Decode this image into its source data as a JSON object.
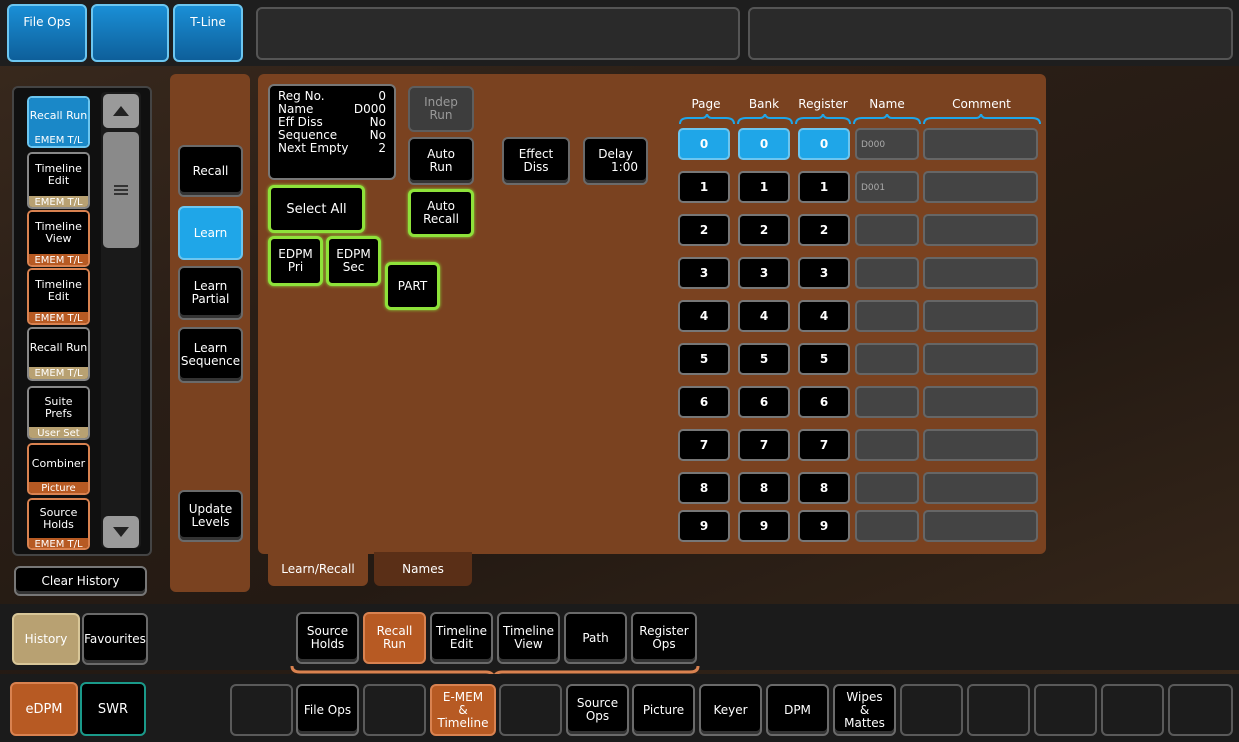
{
  "top_bar": {
    "file_ops": "File Ops",
    "t_line": "T-Line"
  },
  "history": {
    "items": [
      {
        "label": "Recall Run",
        "sub": "EMEM T/L",
        "style": "blue"
      },
      {
        "label": "Timeline Edit",
        "sub": "EMEM T/L",
        "style": "tan"
      },
      {
        "label": "Timeline View",
        "sub": "EMEM T/L",
        "style": "orange"
      },
      {
        "label": "Timeline Edit",
        "sub": "EMEM T/L",
        "style": "orange"
      },
      {
        "label": "Recall Run",
        "sub": "EMEM T/L",
        "style": "tan"
      },
      {
        "label": "Suite Prefs",
        "sub": "User Set",
        "style": "tan"
      },
      {
        "label": "Combiner",
        "sub": "Picture",
        "style": "orange"
      },
      {
        "label": "Source Holds",
        "sub": "EMEM T/L",
        "style": "orange"
      }
    ],
    "clear_label": "Clear History",
    "tab_history": "History",
    "tab_favourites": "Favourites"
  },
  "mode": {
    "edpm": "eDPM",
    "swr": "SWR"
  },
  "side_buttons": {
    "recall": "Recall",
    "learn": "Learn",
    "learn_partial": "Learn Partial",
    "learn_sequence": "Learn Sequence",
    "update_levels": "Update Levels"
  },
  "info": {
    "reg_no_label": "Reg No.",
    "reg_no": "0",
    "name_label": "Name",
    "name": "D000",
    "eff_diss_label": "Eff Diss",
    "eff_diss": "No",
    "sequence_label": "Sequence",
    "sequence": "No",
    "next_empty_label": "Next Empty",
    "next_empty": "2"
  },
  "controls": {
    "indep_run": "Indep Run",
    "auto_run": "Auto Run",
    "effect_diss": "Effect Diss",
    "delay_label": "Delay",
    "delay_value": "1:00",
    "select_all": "Select All",
    "auto_recall": "Auto Recall",
    "edpm_pri": "EDPM Pri",
    "edpm_sec": "EDPM Sec",
    "part": "PART"
  },
  "table": {
    "headers": {
      "page": "Page",
      "bank": "Bank",
      "register": "Register",
      "name": "Name",
      "comment": "Comment"
    },
    "rows": [
      {
        "page": "0",
        "bank": "0",
        "register": "0",
        "name": "D000",
        "comment": ""
      },
      {
        "page": "1",
        "bank": "1",
        "register": "1",
        "name": "D001",
        "comment": ""
      },
      {
        "page": "2",
        "bank": "2",
        "register": "2",
        "name": "",
        "comment": ""
      },
      {
        "page": "3",
        "bank": "3",
        "register": "3",
        "name": "",
        "comment": ""
      },
      {
        "page": "4",
        "bank": "4",
        "register": "4",
        "name": "",
        "comment": ""
      },
      {
        "page": "5",
        "bank": "5",
        "register": "5",
        "name": "",
        "comment": ""
      },
      {
        "page": "6",
        "bank": "6",
        "register": "6",
        "name": "",
        "comment": ""
      },
      {
        "page": "7",
        "bank": "7",
        "register": "7",
        "name": "",
        "comment": ""
      },
      {
        "page": "8",
        "bank": "8",
        "register": "8",
        "name": "",
        "comment": ""
      },
      {
        "page": "9",
        "bank": "9",
        "register": "9",
        "name": "",
        "comment": ""
      }
    ]
  },
  "panel_tabs": {
    "learn_recall": "Learn/Recall",
    "names": "Names"
  },
  "sub_tabs": [
    {
      "label": "Source Holds",
      "active": false
    },
    {
      "label": "Recall Run",
      "active": true
    },
    {
      "label": "Timeline Edit",
      "active": false
    },
    {
      "label": "Timeline View",
      "active": false
    },
    {
      "label": "Path",
      "active": false
    },
    {
      "label": "Register Ops",
      "active": false
    }
  ],
  "main_tabs": [
    {
      "label": "",
      "active": false
    },
    {
      "label": "File Ops",
      "active": false
    },
    {
      "label": "",
      "active": false
    },
    {
      "label": "E-MEM & Timeline",
      "active": true
    },
    {
      "label": "",
      "active": false
    },
    {
      "label": "Source Ops",
      "active": false
    },
    {
      "label": "Picture",
      "active": false
    },
    {
      "label": "Keyer",
      "active": false
    },
    {
      "label": "DPM",
      "active": false
    },
    {
      "label": "Wipes & Mattes",
      "active": false
    },
    {
      "label": "",
      "active": false
    },
    {
      "label": "",
      "active": false
    },
    {
      "label": "",
      "active": false
    },
    {
      "label": "",
      "active": false
    },
    {
      "label": "",
      "active": false
    }
  ],
  "colors": {
    "accent_blue": "#1fa6e8",
    "accent_green": "#8ee23a",
    "accent_orange": "#b75a23",
    "panel_brown": "#7a4220"
  }
}
